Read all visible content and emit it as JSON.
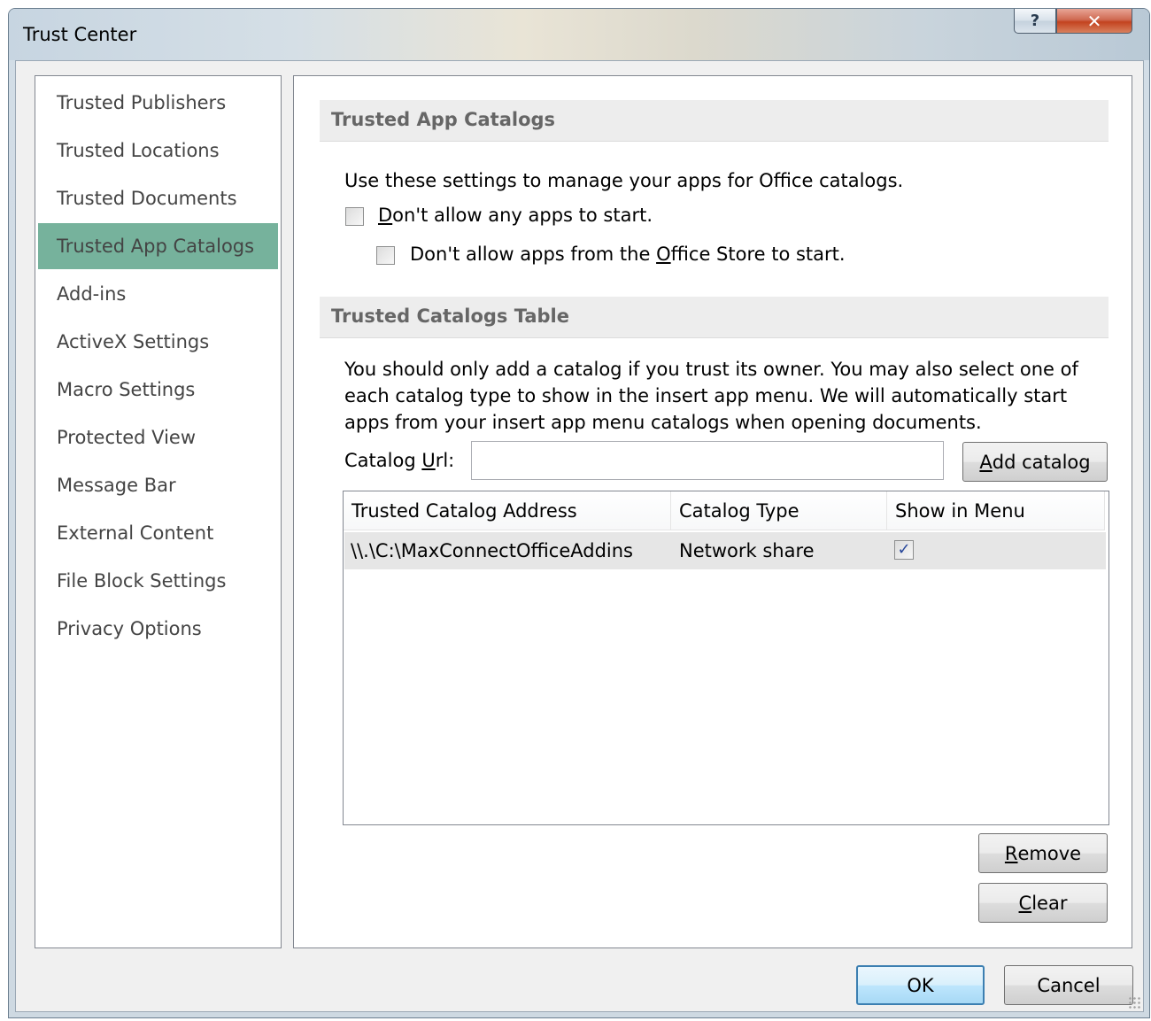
{
  "window": {
    "title": "Trust Center",
    "help_glyph": "?",
    "close_glyph": "✕"
  },
  "nav": {
    "items": [
      {
        "label": "Trusted Publishers"
      },
      {
        "label": "Trusted Locations"
      },
      {
        "label": "Trusted Documents"
      },
      {
        "label": "Trusted App Catalogs",
        "selected": true
      },
      {
        "label": "Add-ins"
      },
      {
        "label": "ActiveX Settings"
      },
      {
        "label": "Macro Settings"
      },
      {
        "label": "Protected View"
      },
      {
        "label": "Message Bar"
      },
      {
        "label": "External Content"
      },
      {
        "label": "File Block Settings"
      },
      {
        "label": "Privacy Options"
      }
    ],
    "selected_color": "#76b29c"
  },
  "catalogs_section": {
    "header": "Trusted App Catalogs",
    "description": "Use these settings to manage your apps for Office catalogs.",
    "option1_prefix": "",
    "option1_accel": "D",
    "option1_suffix": "on't allow any apps to start.",
    "option1_checked": false,
    "option2_prefix": "Don't allow apps from the ",
    "option2_accel": "O",
    "option2_suffix": "ffice Store to start.",
    "option2_checked": false
  },
  "table_section": {
    "header": "Trusted Catalogs Table",
    "description": "You should only add a catalog if you trust its owner. You may also select one of each catalog type to show in the insert app menu. We will automatically start apps from your insert app menu catalogs when opening documents.",
    "url_label_prefix": "Catalog ",
    "url_label_accel": "U",
    "url_label_suffix": "rl:",
    "url_value": "",
    "add_button_accel": "A",
    "add_button_rest": "dd catalog",
    "columns": [
      "Trusted Catalog Address",
      "Catalog Type",
      "Show in Menu"
    ],
    "rows": [
      {
        "address": "\\\\.\\C:\\MaxConnectOfficeAddins",
        "type": "Network share",
        "show_in_menu": true,
        "check_glyph": "✓"
      }
    ],
    "remove_accel": "R",
    "remove_rest": "emove",
    "clear_accel": "C",
    "clear_rest": "lear"
  },
  "footer": {
    "ok_label": "OK",
    "cancel_label": "Cancel"
  }
}
